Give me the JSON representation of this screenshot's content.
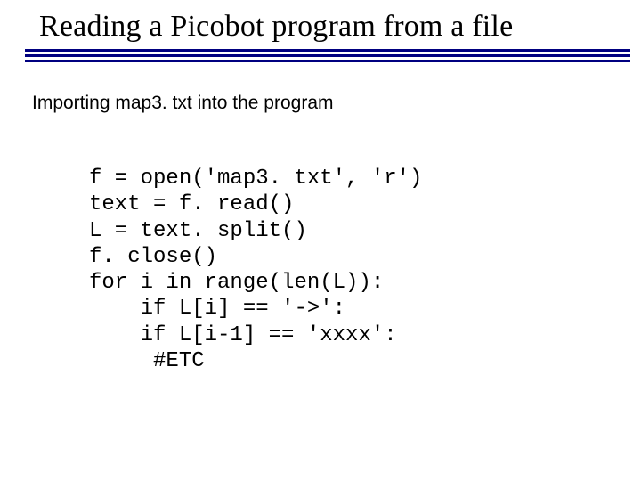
{
  "title": "Reading a Picobot program from a file",
  "subtitle": "Importing map3. txt into the program",
  "code": {
    "l1": "f = open('map3. txt', 'r')",
    "l2": "text = f. read()",
    "l3": "L = text. split()",
    "l4": "f. close()",
    "l5": "for i in range(len(L)):",
    "l6": "    if L[i] == '->':",
    "l7": "    if L[i-1] == 'xxxx':",
    "l8": "     #ETC"
  }
}
